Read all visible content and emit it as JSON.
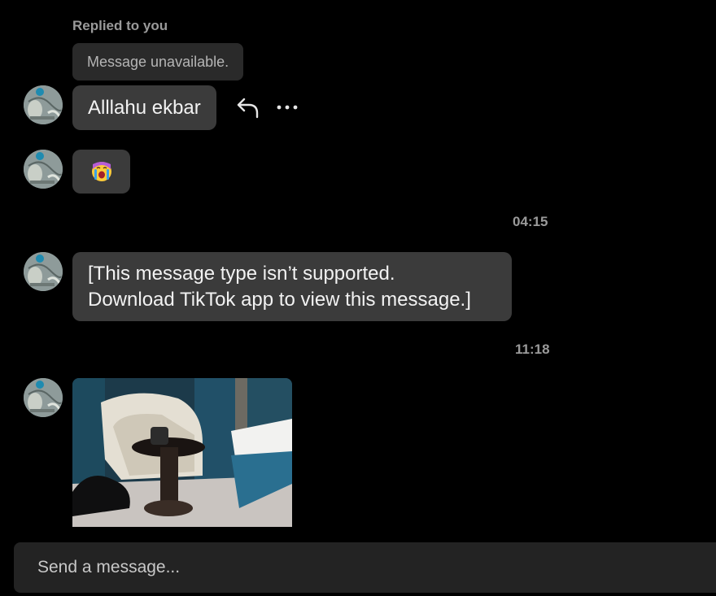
{
  "thread": {
    "replied_label": "Replied to you",
    "quoted_text": "Message unavailable.",
    "timestamps": [
      "04:15",
      "11:18"
    ]
  },
  "messages": [
    {
      "type": "text",
      "text": "Alllahu ekbar"
    },
    {
      "type": "emoji",
      "emoji": "😭"
    },
    {
      "type": "unsupported",
      "line1": "[This message type isn’t supported.",
      "line2": "Download TikTok app to view this message.]"
    },
    {
      "type": "image",
      "alt": "bedroom-video-thumbnail"
    }
  ],
  "actions": {
    "reply_icon": "reply-arrow-icon",
    "more_icon": "more-dots-icon"
  },
  "composer": {
    "placeholder": "Send a message..."
  },
  "colors": {
    "background": "#000000",
    "bubble": "#3b3b3b",
    "quoted": "#2a2a2a",
    "composer": "#232323",
    "muted_text": "#9a9a9a"
  }
}
